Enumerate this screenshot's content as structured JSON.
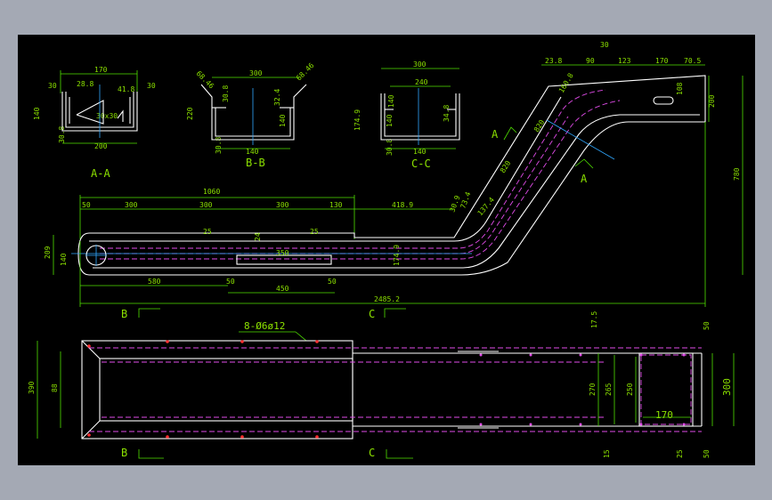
{
  "sections": {
    "aa_label": "A-A",
    "bb_label": "B-B",
    "cc_label": "C-C"
  },
  "section_aa": {
    "d_top": "170",
    "d_left1": "30",
    "d_mid": "28.8",
    "d_right": "30",
    "d_r1": "41.8",
    "d_h": "140",
    "d_note": "30x30",
    "d_b1": "30.8",
    "d_bot": "200"
  },
  "section_bb": {
    "d_top": "300",
    "d_tl": "68.46",
    "d_tr": "68.46",
    "d_h": "220",
    "d_a": "30.8",
    "d_b": "32.4",
    "d_c": "140",
    "d_b1": "30.8",
    "d_bot": "140"
  },
  "section_cc": {
    "d_top": "300",
    "d_top2": "240",
    "d_h1": "140",
    "d_h2": "174.9",
    "d_h3": "140",
    "d_h4": "34.8",
    "d_b1": "30.8",
    "d_bot": "140"
  },
  "side_view": {
    "top_total": "1060",
    "top_segs": [
      "50",
      "300",
      "300",
      "300",
      "130"
    ],
    "d_418": "418.9",
    "d_angles": [
      "30.9",
      "73.4",
      "137.4"
    ],
    "d_slope1": "820",
    "d_slope2": "820",
    "d_top_right": [
      "23.8",
      "90",
      "30",
      "123",
      "170",
      "70.5"
    ],
    "d_160": "160.8",
    "d_200": "200",
    "d_780": "780",
    "d_140": "140",
    "d_209": "209",
    "d_25a": "25",
    "d_24": "24",
    "d_350": "350",
    "d_25b": "25",
    "d_174": "174.9",
    "d_580": "580",
    "d_50a": "50",
    "d_450": "450",
    "d_50b": "50",
    "d_total": "2485.2",
    "d_168": "108",
    "label_a1": "A",
    "label_a2": "A",
    "label_b": "B",
    "label_c": "C"
  },
  "plan_view": {
    "holes_note": "8-Ø6ø12",
    "d_390": "390",
    "d_inner": "88",
    "d_17": "17.5",
    "d_270": "270",
    "d_265": "265",
    "d_250": "250",
    "d_170": "170",
    "d_15": "15",
    "d_50a": "50",
    "d_300": "300",
    "d_25": "25",
    "d_50b": "50",
    "label_b": "B",
    "label_c": "C"
  }
}
